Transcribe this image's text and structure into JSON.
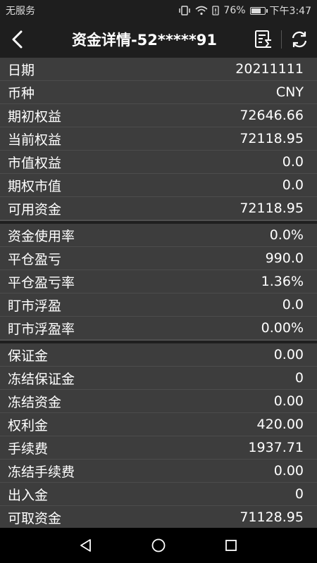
{
  "status": {
    "carrier": "无服务",
    "battery": "76%",
    "battery_level": 0.76,
    "time": "下午3:47"
  },
  "header": {
    "title": "资金详情-52*****91",
    "back_icon": "back-icon",
    "list_icon": "list-sum-icon",
    "refresh_icon": "refresh-icon"
  },
  "sections": [
    {
      "rows": [
        {
          "label": "日期",
          "value": "20211111"
        },
        {
          "label": "币种",
          "value": "CNY"
        },
        {
          "label": "期初权益",
          "value": "72646.66"
        },
        {
          "label": "当前权益",
          "value": "72118.95"
        },
        {
          "label": "市值权益",
          "value": "0.0"
        },
        {
          "label": "期权市值",
          "value": "0.0"
        },
        {
          "label": "可用资金",
          "value": "72118.95"
        }
      ]
    },
    {
      "rows": [
        {
          "label": "资金使用率",
          "value": "0.0%"
        },
        {
          "label": "平仓盈亏",
          "value": "990.0"
        },
        {
          "label": "平仓盈亏率",
          "value": "1.36%"
        },
        {
          "label": "盯市浮盈",
          "value": "0.0"
        },
        {
          "label": "盯市浮盈率",
          "value": "0.00%"
        }
      ]
    },
    {
      "rows": [
        {
          "label": "保证金",
          "value": "0.00"
        },
        {
          "label": "冻结保证金",
          "value": "0"
        },
        {
          "label": "冻结资金",
          "value": "0.00"
        },
        {
          "label": "权利金",
          "value": "420.00"
        },
        {
          "label": "手续费",
          "value": "1937.71"
        },
        {
          "label": "冻结手续费",
          "value": "0.00"
        },
        {
          "label": "出入金",
          "value": "0"
        },
        {
          "label": "可取资金",
          "value": "71128.95"
        }
      ]
    }
  ]
}
